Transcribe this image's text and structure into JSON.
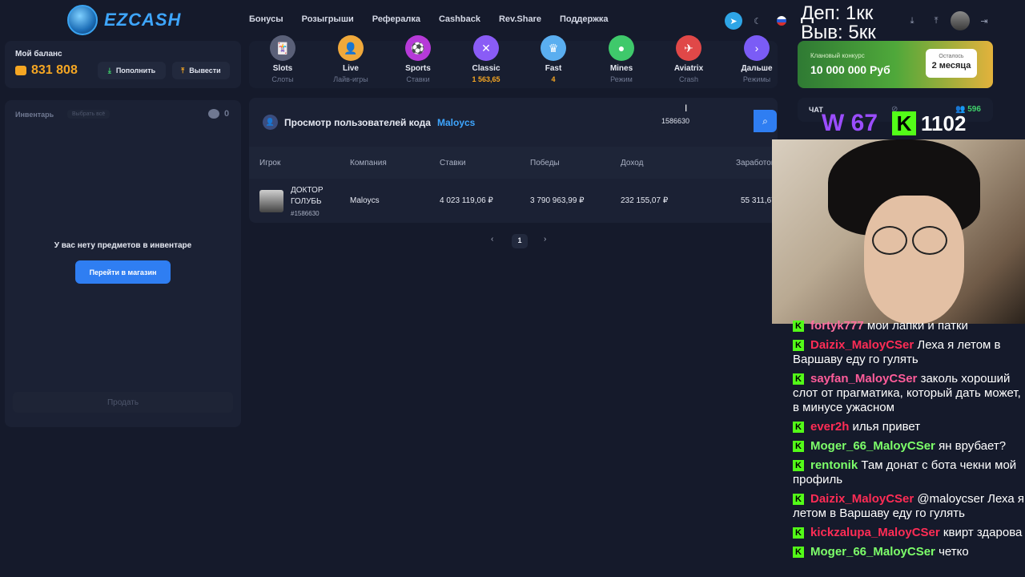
{
  "brand": {
    "name": "EZCASH"
  },
  "nav": {
    "items": [
      "Бонусы",
      "Розыгрыши",
      "Рефералка",
      "Cashback",
      "Rev.Share",
      "Поддержка"
    ]
  },
  "overlay": {
    "dep": "Деп: 1кк",
    "vyv": "Выв: 5кк"
  },
  "balance": {
    "label": "Мой баланс",
    "value": "831 808",
    "deposit": "Пополнить",
    "withdraw": "Вывести"
  },
  "games": [
    {
      "name": "Slots",
      "sub": "Слоты",
      "color": "#5a6078"
    },
    {
      "name": "Live",
      "sub": "Лайв-игры",
      "color": "#f0a93b"
    },
    {
      "name": "Sports",
      "sub": "Ставки",
      "color": "#b63ad8"
    },
    {
      "name": "Classic",
      "sub": "1 563,65",
      "color": "#8a5cf6"
    },
    {
      "name": "Fast",
      "sub": "4",
      "color": "#5aaef0"
    },
    {
      "name": "Mines",
      "sub": "Режим",
      "color": "#3fc96b"
    },
    {
      "name": "Aviatrix",
      "sub": "Crash",
      "color": "#e04848"
    },
    {
      "name": "Дальше",
      "sub": "Режимы",
      "color": "#7b5cf6"
    }
  ],
  "promo": {
    "title": "Клановый конкурс",
    "amount": "10 000 000 Руб",
    "left_label": "Осталось",
    "left_value": "2 месяца"
  },
  "inventory": {
    "title": "Инвентарь",
    "select_all": "Выбрать всё",
    "count": "0",
    "empty": "У вас нету предметов в инвентаре",
    "shop_button": "Перейти в магазин",
    "sell_button": "Продать"
  },
  "main": {
    "title": "Просмотр пользователей кода",
    "code": "Maloycs",
    "search_value": "1586630",
    "columns": [
      "Игрок",
      "Компания",
      "Ставки",
      "Победы",
      "Доход",
      "Заработок"
    ],
    "row": {
      "name_line1": "ДОКТОР",
      "name_line2": "ГОЛУБЬ",
      "id": "#1586630",
      "company": "Maloycs",
      "bets": "4 023 119,06 ₽",
      "wins": "3 790 963,99 ₽",
      "income": "232 155,07 ₽",
      "earn": "55 311,67"
    },
    "page": "1"
  },
  "chat": {
    "label": "ЧАТ",
    "viewers": "596",
    "w_label": "W 67",
    "k_count": "1102",
    "messages": [
      {
        "user": "fortyk777",
        "color": "#ff6fa0",
        "text": "мои лапки и патки"
      },
      {
        "user": "Daizix_MaloyCSer",
        "color": "#ff2c55",
        "text": "Леха я летом в Варшаву еду го гулять"
      },
      {
        "user": "sayfan_MaloyCSer",
        "color": "#ff5c9a",
        "text": "заколь хороший слот от прагматика, который дать может, в минусе ужасном"
      },
      {
        "user": "ever2h",
        "color": "#ff2c55",
        "text": "илья привет"
      },
      {
        "user": "Moger_66_MaloyCSer",
        "color": "#7dff6a",
        "text": "ян врубает?"
      },
      {
        "user": "rentonik",
        "color": "#7dff6a",
        "text": "Там донат с бота чекни мой профиль"
      },
      {
        "user": "Daizix_MaloyCSer",
        "color": "#ff2c55",
        "text": "@maloycser Леха я летом в Варшаву еду го гулять"
      },
      {
        "user": "kickzalupa_MaloyCSer",
        "color": "#ff2c55",
        "text": "квирт здарова"
      },
      {
        "user": "Moger_66_MaloyCSer",
        "color": "#7dff6a",
        "text": "четко"
      }
    ]
  }
}
